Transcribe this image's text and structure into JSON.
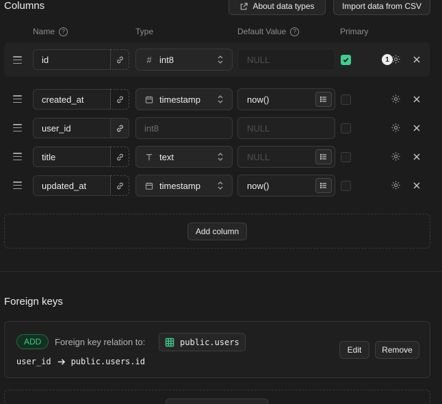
{
  "columns_section": {
    "title": "Columns",
    "about_label": "About data types",
    "import_label": "Import data from CSV",
    "headers": {
      "name": "Name",
      "type": "Type",
      "default": "Default Value",
      "primary": "Primary"
    },
    "help_glyph": "?",
    "add_column_label": "Add column"
  },
  "rows": [
    {
      "name": "id",
      "type_icon": "hash-icon",
      "type": "int8",
      "default": "",
      "default_placeholder": "NULL",
      "primary": true,
      "badge": "1"
    },
    {
      "name": "created_at",
      "type_icon": "calendar-icon",
      "type": "timestamp",
      "default": "now()",
      "default_placeholder": "",
      "primary": false
    },
    {
      "name": "user_id",
      "type_icon": "",
      "type": "int8",
      "default": "",
      "default_placeholder": "NULL",
      "primary": false
    },
    {
      "name": "title",
      "type_icon": "text-type-icon",
      "type": "text",
      "default": "",
      "default_placeholder": "NULL",
      "primary": false
    },
    {
      "name": "updated_at",
      "type_icon": "calendar-icon",
      "type": "timestamp",
      "default": "now()",
      "default_placeholder": "",
      "primary": false
    }
  ],
  "foreign_keys": {
    "title": "Foreign keys",
    "badge": "ADD",
    "relation_label": "Foreign key relation to:",
    "target_table": "public.users",
    "source_column": "user_id",
    "target_column": "public.users.id",
    "edit_label": "Edit",
    "remove_label": "Remove"
  },
  "colors": {
    "accent": "#3ecf8e",
    "background": "#1c1c1c"
  }
}
